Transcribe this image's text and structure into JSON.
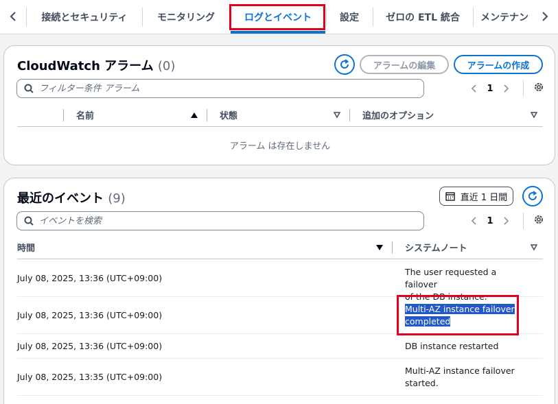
{
  "tabs": [
    {
      "label": "接続とセキュリティ"
    },
    {
      "label": "モニタリング"
    },
    {
      "label": "ログとイベント"
    },
    {
      "label": "設定"
    },
    {
      "label": "ゼロの ETL 統合"
    },
    {
      "label": "メンテナン"
    }
  ],
  "active_tab": 2,
  "alarms": {
    "title": "CloudWatch アラーム",
    "count": "(0)",
    "edit_button": "アラームの編集",
    "create_button": "アラームの作成",
    "search_placeholder": "フィルター条件 アラーム",
    "page": "1",
    "columns": [
      "名前",
      "状態",
      "追加のオプション"
    ],
    "empty_message": "アラーム は存在しません"
  },
  "events": {
    "title": "最近のイベント",
    "count": "(9)",
    "range_button": "直近 1 日間",
    "search_placeholder": "イベントを検索",
    "page": "1",
    "columns": [
      "時間",
      "システムノート"
    ],
    "rows": [
      {
        "time": "July 08, 2025, 13:36 (UTC+09:00)",
        "note_lines": [
          "The user requested a failover",
          "of the DB instance."
        ]
      },
      {
        "time": "July 08, 2025, 13:36 (UTC+09:00)",
        "note_lines": [
          "Multi-AZ instance failover",
          "completed"
        ]
      },
      {
        "time": "July 08, 2025, 13:36 (UTC+09:00)",
        "note_lines": [
          "DB instance restarted"
        ]
      },
      {
        "time": "July 08, 2025, 13:35 (UTC+09:00)",
        "note_lines": [
          "Multi-AZ instance failover",
          "started."
        ]
      }
    ]
  },
  "colors": {
    "accent": "#0972d3",
    "highlight_box": "#e0001b",
    "selection": "#2358c8"
  }
}
